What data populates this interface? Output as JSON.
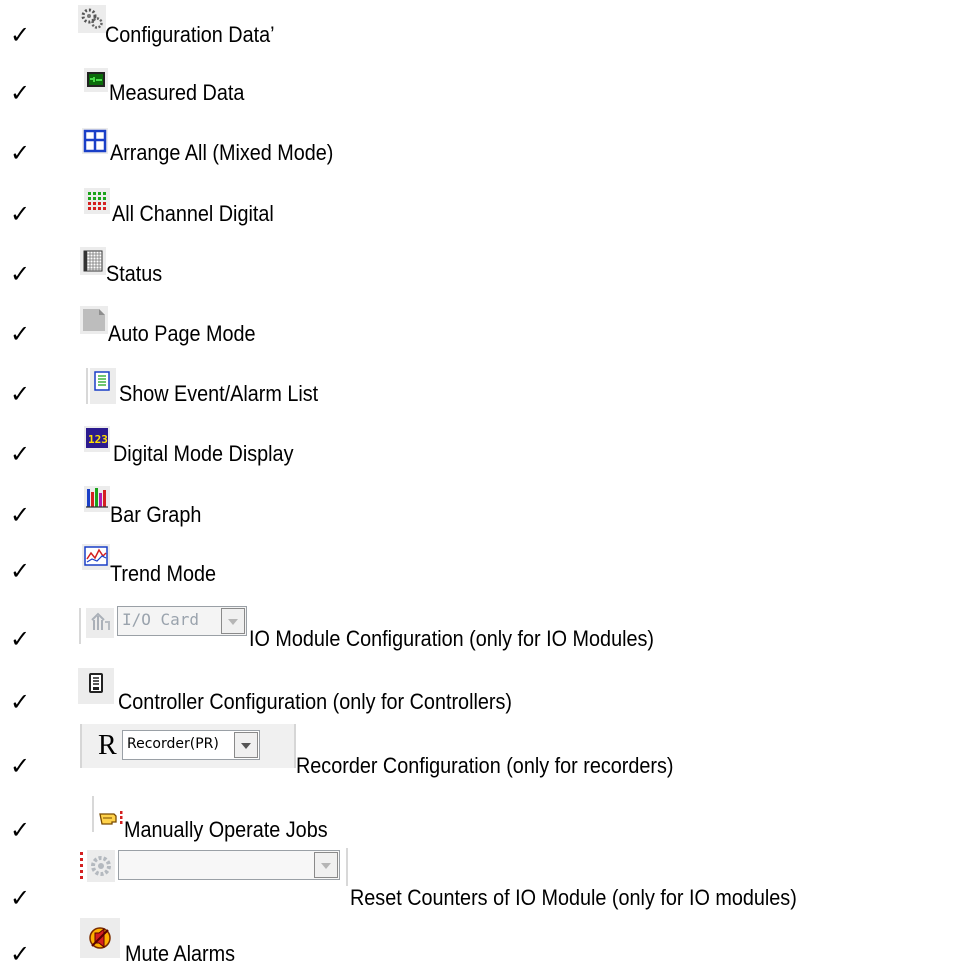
{
  "check_mark": "✓",
  "items": [
    {
      "label": "Configuration Data’",
      "icon": "gears-icon"
    },
    {
      "label": "Measured Data",
      "icon": "monitor-icon"
    },
    {
      "label": "Arrange All (Mixed Mode)",
      "icon": "tile-windows-icon"
    },
    {
      "label": "All Channel Digital",
      "icon": "digital-grid-icon"
    },
    {
      "label": "Status",
      "icon": "status-grid-icon"
    },
    {
      "label": "Auto Page Mode",
      "icon": "page-fold-icon"
    },
    {
      "label": "Show Event/Alarm List",
      "icon": "event-list-icon"
    },
    {
      "label": "Digital Mode Display",
      "icon": "digital-123-icon"
    },
    {
      "label": "Bar Graph",
      "icon": "bar-graph-icon"
    },
    {
      "label": "Trend Mode",
      "icon": "trend-icon"
    },
    {
      "label": "IO Module Configuration (only for IO Modules)",
      "icon": "io-card-icon",
      "combo_value": "I/O Card"
    },
    {
      "label": "Controller Configuration (only for Controllers)",
      "icon": "controller-icon"
    },
    {
      "label": "Recorder Configuration (only for recorders)",
      "icon": "recorder-r-icon",
      "r_letter": "R",
      "combo_value": "Recorder(PR)"
    },
    {
      "label": "Manually Operate Jobs",
      "icon": "hand-pointer-icon"
    },
    {
      "label": "Reset Counters of IO Module (only for IO modules)",
      "icon": "reset-counter-icon",
      "combo_value": ""
    },
    {
      "label": "Mute Alarms",
      "icon": "mute-alarm-icon"
    }
  ],
  "colors": {
    "blue": "#1a3fc7",
    "green": "#1aa31a",
    "red": "#d42020",
    "purple": "#2b1a8e",
    "yellow": "#ffe000"
  }
}
